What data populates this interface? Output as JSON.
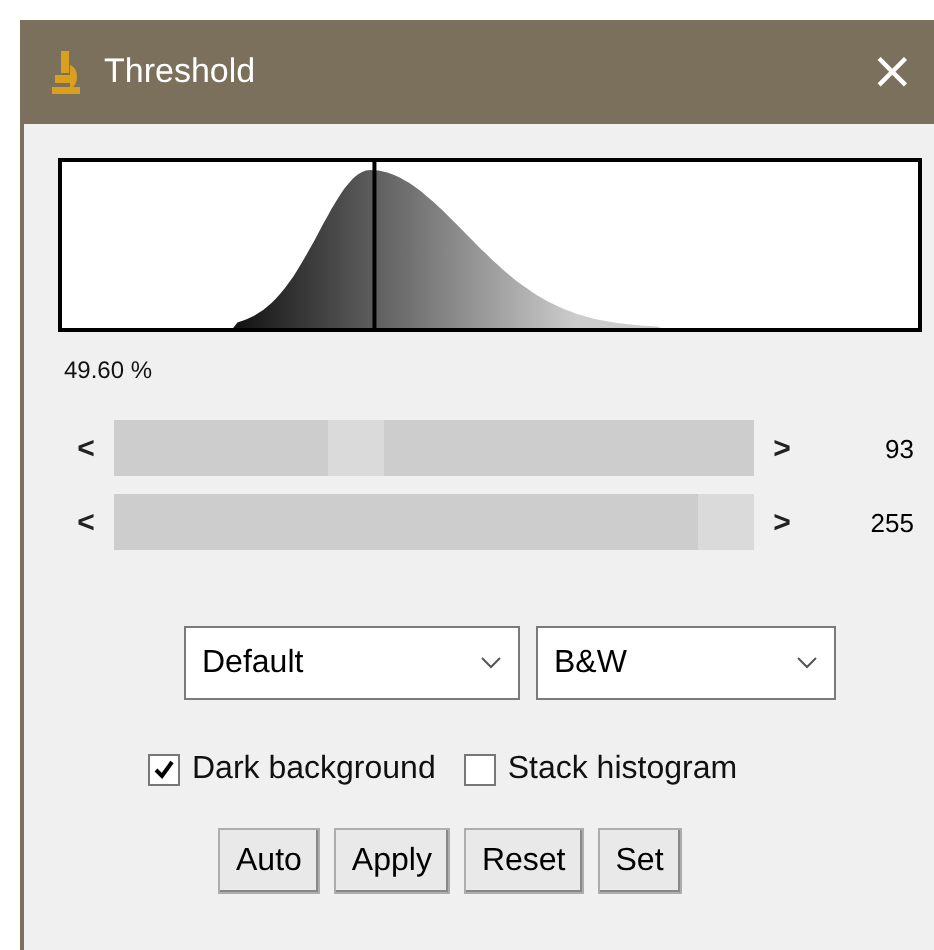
{
  "window": {
    "title": "Threshold",
    "close": "×"
  },
  "histogram": {
    "percent": "49.60 %"
  },
  "sliders": [
    {
      "left": "<",
      "right": ">",
      "level": 0.365,
      "reading": "93"
    },
    {
      "left": "<",
      "right": ">",
      "level": 1,
      "reading": "255"
    }
  ],
  "dropdowns": [
    {
      "value": "Default"
    },
    {
      "value": "B&W"
    }
  ],
  "checkboxes": [
    {
      "label": "Dark background",
      "checked": true
    },
    {
      "label": "Stack histogram",
      "checked": false
    }
  ],
  "buttons": [
    "Auto",
    "Apply",
    "Reset",
    "Set"
  ]
}
